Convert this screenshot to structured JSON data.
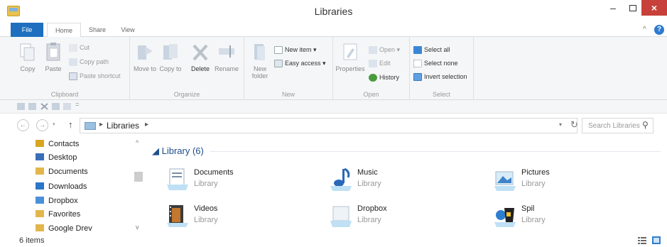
{
  "window": {
    "title": "Libraries",
    "minimize": "–",
    "close": "×"
  },
  "ribbon_tabs": {
    "file": "File",
    "home": "Home",
    "share": "Share",
    "view": "View"
  },
  "ribbon": {
    "clipboard": {
      "label": "Clipboard",
      "copy": "Copy",
      "paste": "Paste",
      "cut": "Cut",
      "copy_path": "Copy path",
      "paste_shortcut": "Paste shortcut"
    },
    "organize": {
      "label": "Organize",
      "move_to": "Move to",
      "copy_to": "Copy to",
      "delete": "Delete",
      "rename": "Rename"
    },
    "new": {
      "label": "New",
      "new_folder": "New folder",
      "new_item": "New item ▾",
      "easy_access": "Easy access ▾"
    },
    "open": {
      "label": "Open",
      "properties": "Properties",
      "open": "Open ▾",
      "edit": "Edit",
      "history": "History"
    },
    "select": {
      "label": "Select",
      "select_all": "Select all",
      "select_none": "Select none",
      "invert_selection": "Invert selection"
    }
  },
  "address": {
    "path": "Libraries",
    "sep": "▸",
    "search_placeholder": "Search Libraries"
  },
  "nav_pane": {
    "items": [
      {
        "label": "Contacts",
        "color": "#d9a520"
      },
      {
        "label": "Desktop",
        "color": "#3a6fb7"
      },
      {
        "label": "Documents",
        "color": "#e2b64c"
      },
      {
        "label": "Downloads",
        "color": "#2a76c8"
      },
      {
        "label": "Dropbox",
        "color": "#4a90d9"
      },
      {
        "label": "Favorites",
        "color": "#e2b64c"
      },
      {
        "label": "Google Drev",
        "color": "#e2b64c"
      }
    ]
  },
  "content": {
    "group_header": "◢ Library (6)",
    "libraries": [
      {
        "name": "Documents",
        "type": "Library",
        "icon": "documents-library-icon"
      },
      {
        "name": "Music",
        "type": "Library",
        "icon": "music-library-icon"
      },
      {
        "name": "Pictures",
        "type": "Library",
        "icon": "pictures-library-icon"
      },
      {
        "name": "Videos",
        "type": "Library",
        "icon": "videos-library-icon"
      },
      {
        "name": "Dropbox",
        "type": "Library",
        "icon": "dropbox-library-icon"
      },
      {
        "name": "Spil",
        "type": "Library",
        "icon": "games-library-icon"
      }
    ]
  },
  "status": {
    "items_count": "6 items"
  },
  "colors": {
    "accent": "#1e6fbf",
    "close": "#c7413a",
    "group_header": "#1e4e8c"
  }
}
